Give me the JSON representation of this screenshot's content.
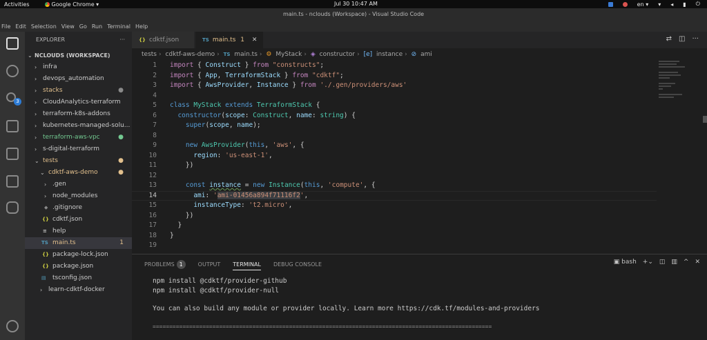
{
  "system_bar": {
    "activities": "Activities",
    "app_name": "Google Chrome ▾",
    "clock": "Jul 30  10:47 AM",
    "lang": "en ▾"
  },
  "window": {
    "title": "main.ts - nclouds (Workspace) - Visual Studio Code"
  },
  "menu": [
    "File",
    "Edit",
    "Selection",
    "View",
    "Go",
    "Run",
    "Terminal",
    "Help"
  ],
  "activity": {
    "scm_badge": "3"
  },
  "explorer": {
    "title": "EXPLORER",
    "more": "···",
    "workspace": "NCLOUDS (WORKSPACE)",
    "items": [
      {
        "label": "infra",
        "mark": ""
      },
      {
        "label": "devops_automation",
        "mark": ""
      },
      {
        "label": "stacks",
        "mark": "●"
      },
      {
        "label": "CloudAnalytics-terraform",
        "mark": ""
      },
      {
        "label": "terraform-k8s-addons",
        "mark": ""
      },
      {
        "label": "kubernetes-managed-solu...",
        "mark": ""
      },
      {
        "label": "terraform-aws-vpc",
        "mark": "●"
      },
      {
        "label": "s-digital-terraform",
        "mark": ""
      },
      {
        "label": "tests",
        "mark": "●"
      },
      {
        "label": "cdktf-aws-demo",
        "mark": "●"
      },
      {
        "label": ".gen",
        "mark": ""
      },
      {
        "label": "node_modules",
        "mark": ""
      },
      {
        "label": ".gitignore",
        "mark": ""
      },
      {
        "label": "cdktf.json",
        "mark": ""
      },
      {
        "label": "help",
        "mark": ""
      },
      {
        "label": "main.ts",
        "mark": "1"
      },
      {
        "label": "package-lock.json",
        "mark": ""
      },
      {
        "label": "package.json",
        "mark": ""
      },
      {
        "label": "tsconfig.json",
        "mark": ""
      },
      {
        "label": "learn-cdktf-docker",
        "mark": ""
      }
    ]
  },
  "tabs": [
    {
      "icon": "{}",
      "label": "cdktf.json"
    },
    {
      "icon": "TS",
      "label": "main.ts",
      "badge": "1",
      "close": "✕"
    }
  ],
  "breadcrumb": {
    "tests": "tests",
    "folder": "cdktf-aws-demo",
    "file": "main.ts",
    "cls": "MyStack",
    "ctor": "constructor",
    "var": "instance",
    "prop": "ami",
    "ts": "TS"
  },
  "code": {
    "line_numbers": [
      "1",
      "2",
      "3",
      "4",
      "5",
      "6",
      "7",
      "8",
      "9",
      "10",
      "11",
      "12",
      "13",
      "14",
      "15",
      "16",
      "17",
      "18",
      "19"
    ],
    "l1": {
      "kw": "import",
      "a": " { ",
      "b": "Construct",
      "c": " } ",
      "d": "from",
      "e": " ",
      "f": "\"constructs\"",
      "g": ";"
    },
    "l2": {
      "kw": "import",
      "a": " { ",
      "b": "App",
      "c": ", ",
      "d": "TerraformStack",
      "e": " } ",
      "f": "from",
      "g": " ",
      "h": "\"cdktf\"",
      "i": ";"
    },
    "l3": {
      "kw": "import",
      "a": " { ",
      "b": "AwsProvider",
      "c": ", ",
      "d": "Instance",
      "e": " } ",
      "f": "from",
      "g": " ",
      "h": "'./.gen/providers/aws'"
    },
    "l5": {
      "kw": "class",
      "a": " ",
      "b": "MyStack",
      "c": " ",
      "d": "extends",
      "e": " ",
      "f": "TerraformStack",
      "g": " {"
    },
    "l6": {
      "a": "  ",
      "b": "constructor",
      "c": "(",
      "d": "scope",
      "e": ": ",
      "f": "Construct",
      "g": ", ",
      "h": "name",
      "i": ": ",
      "j": "string",
      "k": ") {"
    },
    "l7": {
      "a": "    ",
      "b": "super",
      "c": "(",
      "d": "scope",
      "e": ", ",
      "f": "name",
      "g": ");"
    },
    "l9": {
      "a": "    ",
      "b": "new",
      "c": " ",
      "d": "AwsProvider",
      "e": "(",
      "f": "this",
      "g": ", ",
      "h": "'aws'",
      "i": ", {"
    },
    "l10": {
      "a": "      ",
      "b": "region",
      "c": ": ",
      "d": "'us-east-1'",
      "e": ","
    },
    "l11": {
      "a": "    })"
    },
    "l13": {
      "a": "    ",
      "b": "const",
      "c": " ",
      "d": "instance",
      "e": " = ",
      "f": "new",
      "g": " ",
      "h": "Instance",
      "i": "(",
      "j": "this",
      "k": ", ",
      "l": "'compute'",
      "m": ", {"
    },
    "l14": {
      "a": "      ",
      "b": "ami",
      "c": ": ",
      "d": "'",
      "e": "ami-01456a894f71116f2",
      "f": "'",
      "g": ","
    },
    "l15": {
      "a": "      ",
      "b": "instanceType",
      "c": ": ",
      "d": "'t2.micro'",
      "e": ","
    },
    "l16": {
      "a": "    })"
    },
    "l17": {
      "a": "  }"
    },
    "l18": {
      "a": "}"
    }
  },
  "panel": {
    "tabs": [
      "PROBLEMS",
      "OUTPUT",
      "TERMINAL",
      "DEBUG CONSOLE"
    ],
    "problems_count": "1",
    "shell": "bash",
    "terminal_lines": [
      "npm install @cdktf/provider-github",
      "npm install @cdktf/provider-null",
      "",
      "You can also build any module or provider locally. Learn more https://cdk.tf/modules-and-providers",
      "",
      "======================================================================================================"
    ]
  }
}
